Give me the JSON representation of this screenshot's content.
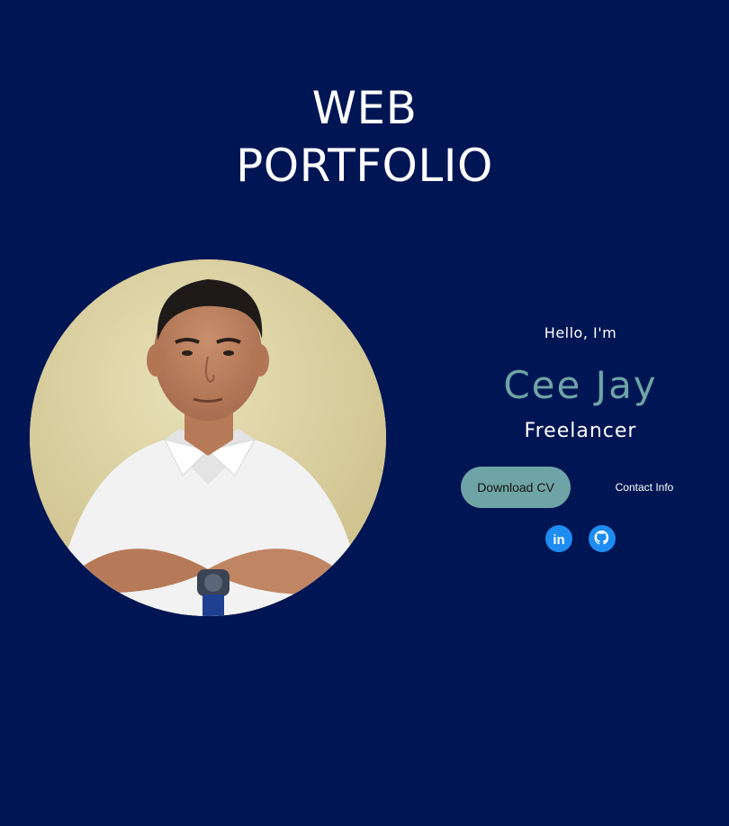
{
  "hero": {
    "title_line1": "WEB",
    "title_line2": "PORTFOLIO",
    "greeting": "Hello, I'm",
    "name": "Cee Jay",
    "role": "Freelancer",
    "download_cv_label": "Download CV",
    "contact_info_label": "Contact Info"
  },
  "social": {
    "linkedin_icon": "linkedin-icon",
    "github_icon": "github-icon"
  },
  "colors": {
    "background": "#001554",
    "accent": "#6fa4a6",
    "social_blue": "#1e8cf0"
  }
}
